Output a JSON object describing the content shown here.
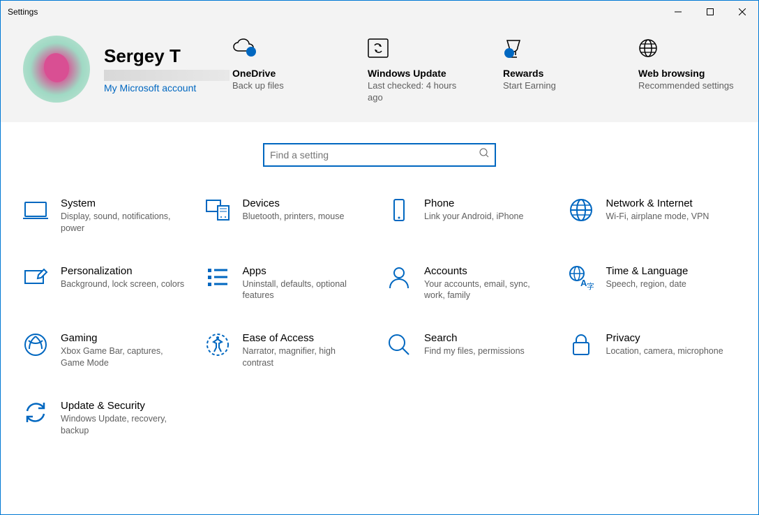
{
  "window": {
    "title": "Settings"
  },
  "profile": {
    "name": "Sergey T",
    "link": "My Microsoft account"
  },
  "tiles": {
    "onedrive": {
      "title": "OneDrive",
      "desc": "Back up files"
    },
    "update": {
      "title": "Windows Update",
      "desc": "Last checked: 4 hours ago"
    },
    "rewards": {
      "title": "Rewards",
      "desc": "Start Earning"
    },
    "browsing": {
      "title": "Web browsing",
      "desc": "Recommended settings"
    }
  },
  "search": {
    "placeholder": "Find a setting"
  },
  "categories": {
    "system": {
      "title": "System",
      "desc": "Display, sound, notifications, power"
    },
    "devices": {
      "title": "Devices",
      "desc": "Bluetooth, printers, mouse"
    },
    "phone": {
      "title": "Phone",
      "desc": "Link your Android, iPhone"
    },
    "network": {
      "title": "Network & Internet",
      "desc": "Wi-Fi, airplane mode, VPN"
    },
    "personal": {
      "title": "Personalization",
      "desc": "Background, lock screen, colors"
    },
    "apps": {
      "title": "Apps",
      "desc": "Uninstall, defaults, optional features"
    },
    "accounts": {
      "title": "Accounts",
      "desc": "Your accounts, email, sync, work, family"
    },
    "time": {
      "title": "Time & Language",
      "desc": "Speech, region, date"
    },
    "gaming": {
      "title": "Gaming",
      "desc": "Xbox Game Bar, captures, Game Mode"
    },
    "ease": {
      "title": "Ease of Access",
      "desc": "Narrator, magnifier, high contrast"
    },
    "searchcat": {
      "title": "Search",
      "desc": "Find my files, permissions"
    },
    "privacy": {
      "title": "Privacy",
      "desc": "Location, camera, microphone"
    },
    "updatesec": {
      "title": "Update & Security",
      "desc": "Windows Update, recovery, backup"
    }
  }
}
